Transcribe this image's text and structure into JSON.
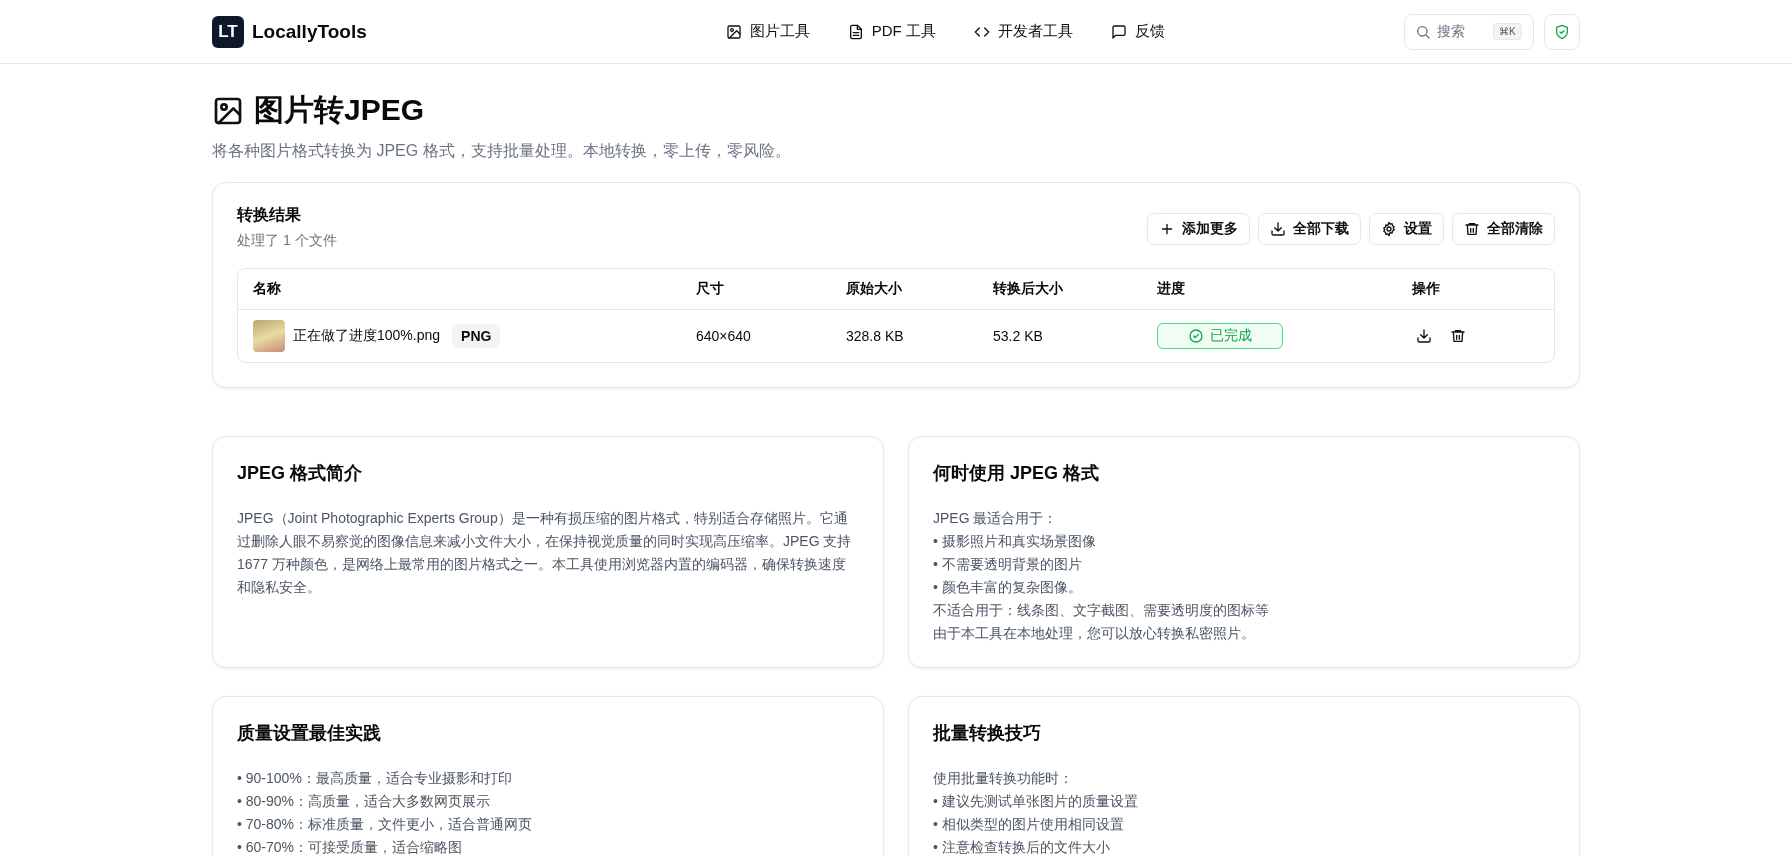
{
  "header": {
    "logo_mark": "LT",
    "logo_text": "LocallyTools",
    "nav": [
      {
        "label": "图片工具"
      },
      {
        "label": "PDF 工具"
      },
      {
        "label": "开发者工具"
      },
      {
        "label": "反馈"
      }
    ],
    "search": {
      "label": "搜索",
      "shortcut": "⌘K"
    }
  },
  "page": {
    "title": "图片转JPEG",
    "subtitle": "将各种图片格式转换为 JPEG 格式，支持批量处理。本地转换，零上传，零风险。"
  },
  "results": {
    "title": "转换结果",
    "summary": "处理了 1 个文件",
    "actions": [
      {
        "label": "添加更多"
      },
      {
        "label": "全部下载"
      },
      {
        "label": "设置"
      },
      {
        "label": "全部清除"
      }
    ],
    "table": {
      "columns": [
        "名称",
        "尺寸",
        "原始大小",
        "转换后大小",
        "进度",
        "操作"
      ],
      "rows": [
        {
          "name": "正在做了进度100%.png",
          "format": "PNG",
          "dimensions": "640×640",
          "original_size": "328.8 KB",
          "converted_size": "53.2 KB",
          "status": {
            "kind": "done",
            "label": "已完成"
          }
        }
      ]
    }
  },
  "info_cards": [
    {
      "title": "JPEG 格式简介",
      "paragraph": "JPEG（Joint Photographic Experts Group）是一种有损压缩的图片格式，特别适合存储照片。它通过删除人眼不易察觉的图像信息来减小文件大小，在保持视觉质量的同时实现高压缩率。JPEG 支持 1677 万种颜色，是网络上最常用的图片格式之一。本工具使用浏览器内置的编码器，确保转换速度和隐私安全。"
    },
    {
      "title": "何时使用 JPEG 格式",
      "lines": [
        "JPEG 最适合用于：",
        "• 摄影照片和真实场景图像",
        "• 不需要透明背景的图片",
        "• 颜色丰富的复杂图像。",
        "不适合用于：线条图、文字截图、需要透明度的图标等",
        "由于本工具在本地处理，您可以放心转换私密照片。"
      ]
    },
    {
      "title": "质量设置最佳实践",
      "lines": [
        "• 90-100%：最高质量，适合专业摄影和打印",
        "• 80-90%：高质量，适合大多数网页展示",
        "• 70-80%：标准质量，文件更小，适合普通网页",
        "• 60-70%：可接受质量，适合缩略图"
      ]
    },
    {
      "title": "批量转换技巧",
      "lines": [
        "使用批量转换功能时：",
        "• 建议先测试单张图片的质量设置",
        "• 相似类型的图片使用相同设置",
        "• 注意检查转换后的文件大小"
      ]
    }
  ]
}
